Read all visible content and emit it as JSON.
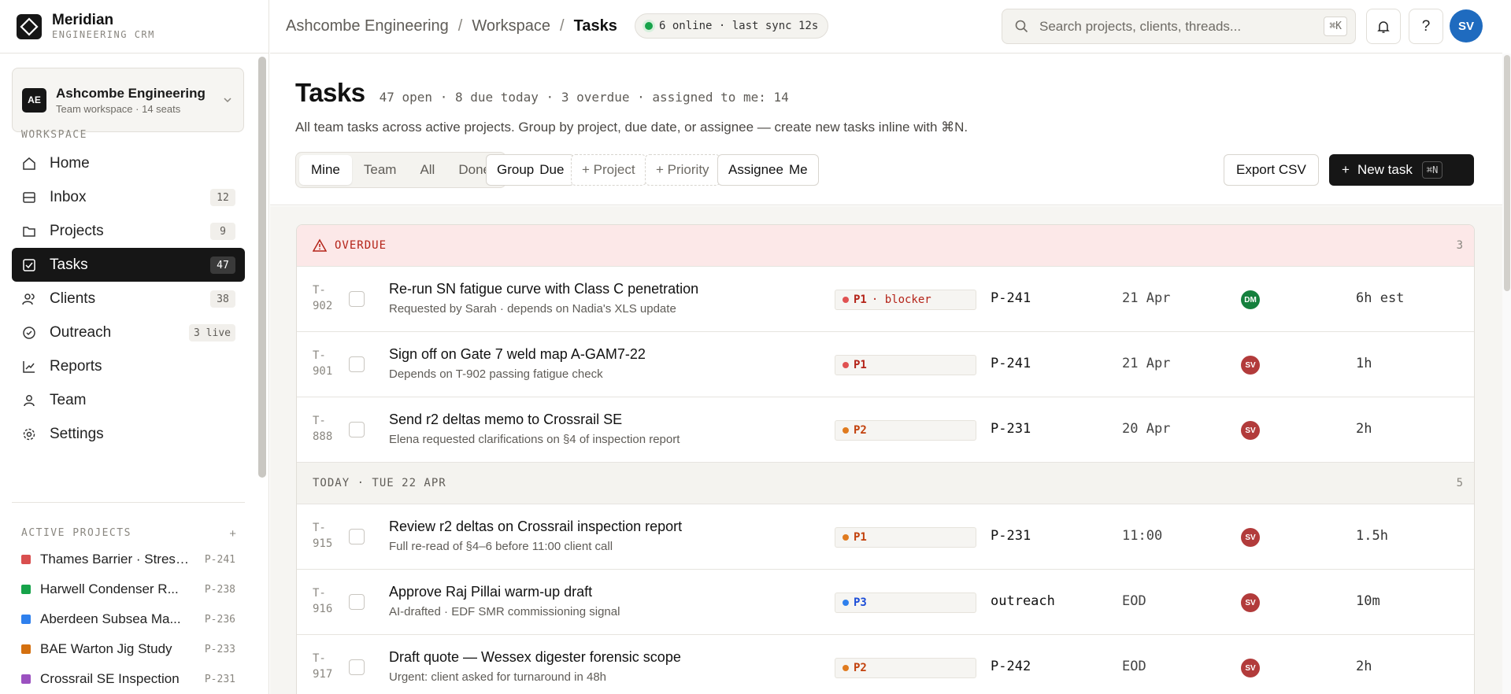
{
  "app": {
    "name": "Meridian",
    "subtitle": "ENGINEERING CRM"
  },
  "workspace": {
    "initials": "AE",
    "name": "Ashcombe Engineering",
    "meta": "Team workspace · 14 seats"
  },
  "sidebar": {
    "workspace_label": "WORKSPACE",
    "nav": [
      {
        "label": "Home",
        "badge": "",
        "icon": "home-icon"
      },
      {
        "label": "Inbox",
        "badge": "12",
        "icon": "inbox-icon"
      },
      {
        "label": "Projects",
        "badge": "9",
        "icon": "folder-icon"
      },
      {
        "label": "Tasks",
        "badge": "47",
        "icon": "tasks-icon",
        "active": true
      },
      {
        "label": "Clients",
        "badge": "38",
        "icon": "clients-icon"
      },
      {
        "label": "Outreach",
        "badge": "3 live",
        "icon": "outreach-icon"
      },
      {
        "label": "Reports",
        "badge": "",
        "icon": "reports-icon"
      },
      {
        "label": "Team",
        "badge": "",
        "icon": "team-icon"
      },
      {
        "label": "Settings",
        "badge": "",
        "icon": "settings-icon"
      }
    ],
    "projects_label": "ACTIVE PROJECTS",
    "projects_add": "+",
    "projects": [
      {
        "name": "Thames Barrier · Stress...",
        "code": "P-241",
        "color": "#d94f4f"
      },
      {
        "name": "Harwell Condenser R...",
        "code": "P-238",
        "color": "#16a34a"
      },
      {
        "name": "Aberdeen Subsea Ma...",
        "code": "P-236",
        "color": "#2f80ed"
      },
      {
        "name": "BAE Warton Jig Study",
        "code": "P-233",
        "color": "#d4700f"
      },
      {
        "name": "Crossrail SE Inspection",
        "code": "P-231",
        "color": "#9b51c0"
      }
    ]
  },
  "topbar": {
    "breadcrumb": [
      "Ashcombe Engineering",
      "Workspace",
      "Tasks"
    ],
    "separator": "/",
    "online_status": "6 online · last sync 12s",
    "search_placeholder": "Search projects, clients, threads...",
    "search_shortcut": "⌘K",
    "help_label": "?",
    "user_initials": "SV"
  },
  "header": {
    "title": "Tasks",
    "stats": "47 open · 8 due today · 3 overdue · assigned to me: 14",
    "description": "All team tasks across active projects. Group by project, due date, or assignee — create new tasks inline with ⌘N.",
    "tabs": [
      "Mine",
      "Team",
      "All",
      "Done"
    ],
    "filters": {
      "group_label": "Group",
      "group_value": "Due",
      "project": "+ Project",
      "priority": "+ Priority",
      "assignee_label": "Assignee",
      "assignee_value": "Me"
    },
    "export_label": "Export CSV",
    "new_task_label": "New task",
    "new_task_plus": "+",
    "new_task_shortcut": "⌘N"
  },
  "groups": [
    {
      "label": "OVERDUE",
      "count": "3",
      "kind": "overdue",
      "rows": [
        {
          "id_a": "T-",
          "id_b": "902",
          "title": "Re-run SN fatigue curve with Class C penetration",
          "sub": "Requested by Sarah · depends on Nadia's XLS update",
          "prio": "P1",
          "prio_extra": "· blocker",
          "prio_color": "red",
          "project": "P-241",
          "due": "21 Apr",
          "assignee": "DM",
          "assignee_color": "green",
          "est": "6h est"
        },
        {
          "id_a": "T-",
          "id_b": "901",
          "title": "Sign off on Gate 7 weld map A-GAM7-22",
          "sub": "Depends on T-902 passing fatigue check",
          "prio": "P1",
          "prio_extra": "",
          "prio_color": "red",
          "project": "P-241",
          "due": "21 Apr",
          "assignee": "SV",
          "assignee_color": "red",
          "est": "1h"
        },
        {
          "id_a": "T-",
          "id_b": "888",
          "title": "Send r2 deltas memo to Crossrail SE",
          "sub": "Elena requested clarifications on §4 of inspection report",
          "prio": "P2",
          "prio_extra": "",
          "prio_color": "orange",
          "project": "P-231",
          "due": "20 Apr",
          "assignee": "SV",
          "assignee_color": "red",
          "est": "2h"
        }
      ]
    },
    {
      "label": "TODAY · TUE 22 APR",
      "count": "5",
      "kind": "today",
      "rows": [
        {
          "id_a": "T-",
          "id_b": "915",
          "title": "Review r2 deltas on Crossrail inspection report",
          "sub": "Full re-read of §4–6 before 11:00 client call",
          "prio": "P1",
          "prio_extra": "",
          "prio_color": "orange",
          "project": "P-231",
          "due": "11:00",
          "assignee": "SV",
          "assignee_color": "red",
          "est": "1.5h"
        },
        {
          "id_a": "T-",
          "id_b": "916",
          "title": "Approve Raj Pillai warm-up draft",
          "sub": "AI-drafted · EDF SMR commissioning signal",
          "prio": "P3",
          "prio_extra": "",
          "prio_color": "blue",
          "project": "outreach",
          "due": "EOD",
          "assignee": "SV",
          "assignee_color": "red",
          "est": "10m"
        },
        {
          "id_a": "T-",
          "id_b": "917",
          "title": "Draft quote — Wessex digester forensic scope",
          "sub": "Urgent: client asked for turnaround in 48h",
          "prio": "P2",
          "prio_extra": "",
          "prio_color": "orange",
          "project": "P-242",
          "due": "EOD",
          "assignee": "SV",
          "assignee_color": "red",
          "est": "2h"
        }
      ]
    }
  ]
}
